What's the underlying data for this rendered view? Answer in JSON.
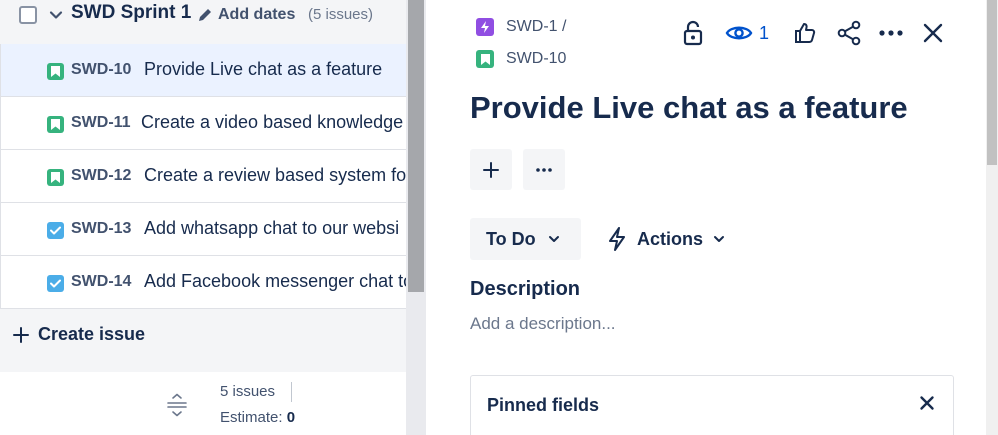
{
  "sprint": {
    "name": "SWD Sprint 1",
    "add_dates": "Add dates",
    "issue_count": "(5 issues)"
  },
  "issues": [
    {
      "key": "SWD-10",
      "summary": "Provide Live chat as a feature",
      "type": "story-icon",
      "selected": true
    },
    {
      "key": "SWD-11",
      "summary": "Create a video based knowledge",
      "type": "story-icon",
      "selected": false
    },
    {
      "key": "SWD-12",
      "summary": "Create a review based system fo",
      "type": "story-icon",
      "selected": false
    },
    {
      "key": "SWD-13",
      "summary": "Add whatsapp chat to our websi",
      "type": "task-icon",
      "selected": false
    },
    {
      "key": "SWD-14",
      "summary": "Add Facebook messenger chat to",
      "type": "task-icon",
      "selected": false
    }
  ],
  "create_issue": "Create issue",
  "footer": {
    "issues": "5 issues",
    "estimate_label": "Estimate:",
    "estimate_value": "0"
  },
  "detail": {
    "parent_key": "SWD-1 /",
    "issue_key": "SWD-10",
    "watch_count": "1",
    "title": "Provide Live chat as a feature",
    "status": "To Do",
    "actions": "Actions",
    "description_label": "Description",
    "description_placeholder": "Add a description...",
    "pinned_fields": "Pinned fields"
  },
  "colors": {
    "story": "#36b37e",
    "task": "#4bade8",
    "epic": "#904ee2",
    "accent": "#0052cc",
    "selected_row": "#ebf2ff"
  }
}
